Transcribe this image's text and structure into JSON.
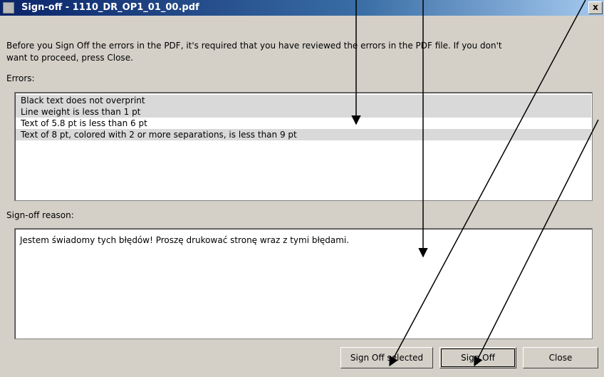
{
  "window": {
    "title": "Sign-off - 1110_DR_OP1_01_00.pdf",
    "close_glyph": "x"
  },
  "intro_text": "Before you Sign Off the errors in the PDF, it's required that you have reviewed the errors in the PDF file. If you don't\nwant to proceed, press Close.",
  "errors": {
    "label": "Errors:",
    "items": [
      {
        "text": "Black text does not overprint",
        "bg": "#d9d9d9"
      },
      {
        "text": "Line weight is less than 1 pt",
        "bg": "#d9d9d9"
      },
      {
        "text": "Text of 5.8 pt is less than 6 pt",
        "bg": "#ffffff"
      },
      {
        "text": "Text of 8 pt, colored with 2 or more separations, is less than 9 pt",
        "bg": "#d9d9d9"
      }
    ]
  },
  "reason": {
    "label": "Sign-off reason:",
    "value": "Jestem świadomy tych błędów! Proszę drukować stronę wraz z tymi błędami."
  },
  "buttons": {
    "sign_off_selected": "Sign Off selected",
    "sign_off": "Sign Off",
    "close": "Close"
  }
}
